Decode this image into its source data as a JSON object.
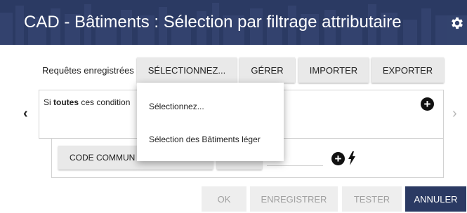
{
  "header": {
    "title": "CAD - Bâtiments : Sélection par filtrage attributaire",
    "settings_icon": "gear-icon",
    "background_color": "#2b3a63"
  },
  "saved_queries": {
    "label": "Requêtes enregistrées :",
    "select_label": "SÉLECTIONNEZ...",
    "manage_label": "GÉRER",
    "import_label": "IMPORTER",
    "export_label": "EXPORTER"
  },
  "conditions": {
    "prefix": "Si",
    "mode": "toutes",
    "suffix": "ces condition"
  },
  "filter_row": {
    "field_label": "CODE COMMUN"
  },
  "dropdown": {
    "items": [
      "Sélectionnez...",
      "Sélection des Bâtiments léger"
    ]
  },
  "footer": {
    "ok_label": "OK",
    "save_label": "ENREGISTRER",
    "test_label": "TESTER",
    "cancel_label": "ANNULER"
  }
}
